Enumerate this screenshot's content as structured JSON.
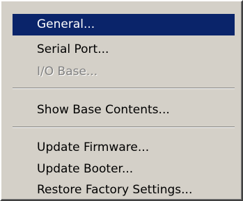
{
  "menu": {
    "items": [
      {
        "label": "General...",
        "state": "highlighted"
      },
      {
        "label": "Serial Port...",
        "state": "normal"
      },
      {
        "label": "I/O Base...",
        "state": "disabled"
      },
      {
        "label": "Show Base Contents...",
        "state": "normal"
      },
      {
        "label": "Update Firmware...",
        "state": "normal"
      },
      {
        "label": "Update Booter...",
        "state": "normal"
      },
      {
        "label": "Restore Factory Settings...",
        "state": "normal"
      }
    ]
  },
  "colors": {
    "menu_background": "#d4d0c8",
    "highlight_background": "#0a246a",
    "highlight_text": "#ffffff",
    "disabled_text": "#808080"
  }
}
